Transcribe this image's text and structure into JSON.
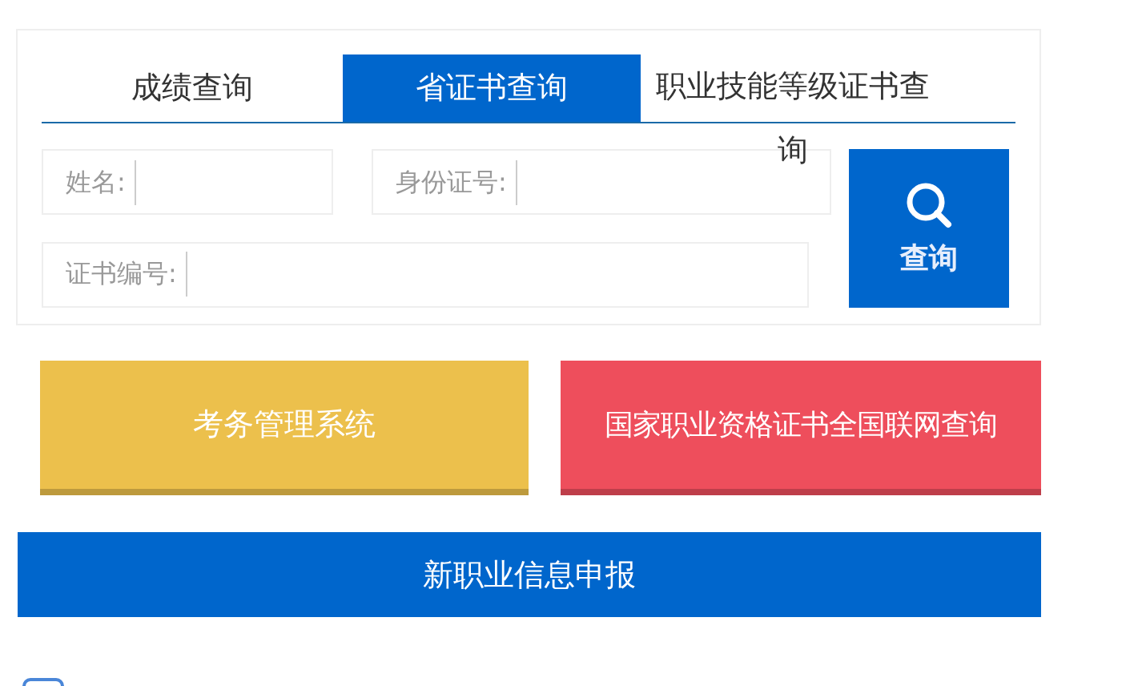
{
  "tabs": [
    {
      "label": "成绩查询",
      "selected": false
    },
    {
      "label": "省证书查询",
      "selected": true
    },
    {
      "label": "职业技能等级证书查询",
      "selected": false
    }
  ],
  "fields": [
    {
      "label": "姓名:"
    },
    {
      "label": "身份证号:"
    },
    {
      "label": "证书编号:"
    }
  ],
  "search_button": {
    "label": "查询"
  },
  "links": [
    {
      "label": "考务管理系统",
      "color": "#ecc04c"
    },
    {
      "label": "国家职业资格证书全国联网查询",
      "color": "#ee4e5c"
    }
  ],
  "banner": {
    "label": "新职业信息申报"
  }
}
